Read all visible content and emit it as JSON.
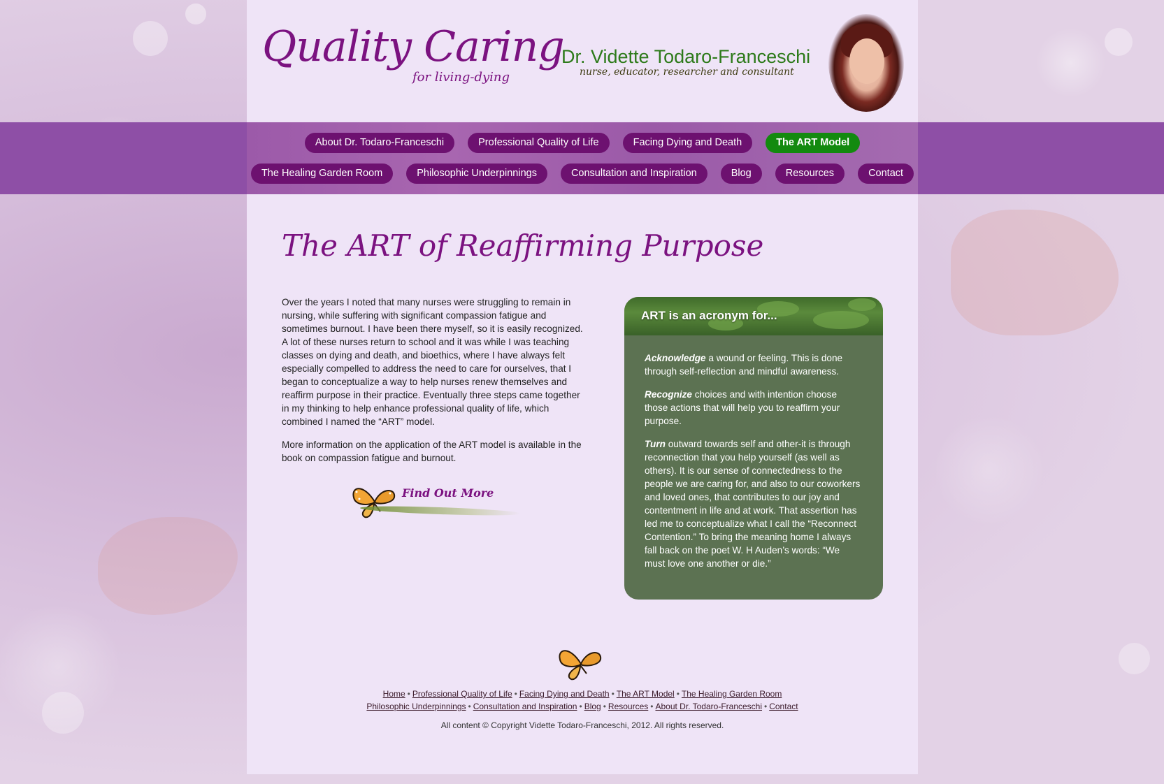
{
  "header": {
    "logo_main": "Quality Caring",
    "logo_sub": "for living-dying",
    "doctor_name": "Dr. Vidette Todaro-Franceschi",
    "doctor_title": "nurse, educator, researcher and consultant"
  },
  "nav": {
    "row1": [
      {
        "label": "About Dr. Todaro-Franceschi",
        "active": false
      },
      {
        "label": "Professional Quality of Life",
        "active": false
      },
      {
        "label": "Facing Dying and Death",
        "active": false
      },
      {
        "label": "The ART Model",
        "active": true
      }
    ],
    "row2": [
      {
        "label": "The Healing Garden Room",
        "active": false
      },
      {
        "label": "Philosophic Underpinnings",
        "active": false
      },
      {
        "label": "Consultation and Inspiration",
        "active": false
      },
      {
        "label": "Blog",
        "active": false
      },
      {
        "label": "Resources",
        "active": false
      },
      {
        "label": "Contact",
        "active": false
      }
    ],
    "colors": {
      "button": "#6d1170",
      "active": "#138a0f",
      "band": "#8e4fa6"
    }
  },
  "main": {
    "title": "The ART of Reaffirming Purpose",
    "paragraphs": [
      "Over the years I noted that many nurses were struggling to remain in nursing, while suffering with significant compassion fatigue and sometimes burnout. I have been there myself, so it is easily recognized. A lot of these nurses return to school and it was while I was teaching classes on dying and death, and bioethics, where I have always felt especially compelled to address the need to care for ourselves, that I began to conceptualize a way to help nurses renew themselves and reaffirm purpose in their practice. Eventually three steps came together in my thinking to help enhance professional quality of life, which combined I named the “ART” model.",
      "More information on the application of the ART model is available in the book on compassion fatigue and burnout."
    ],
    "find_more_label": "Find Out More"
  },
  "art_box": {
    "title": "ART is an acronym for...",
    "items": [
      {
        "term": "Acknowledge",
        "text": " a wound or feeling. This is done through self-reflection and mindful awareness."
      },
      {
        "term": "Recognize",
        "text": " choices and with intention choose those actions that will help you to reaffirm your purpose."
      },
      {
        "term": "Turn",
        "text": " outward towards self and other-it is through reconnection that you help yourself (as well as others). It is our sense of connectedness to the people we are caring for, and also to our coworkers and loved ones, that contributes to our joy and contentment in life and at work. That assertion has led me to conceptualize what I call the “Reconnect Contention.” To bring the meaning home I always fall back on the poet W. H Auden’s words: “We must love one another or die.”"
      }
    ]
  },
  "footer": {
    "row1": [
      "Home",
      "Professional Quality of Life",
      "Facing Dying and Death",
      "The ART Model",
      "The Healing Garden Room"
    ],
    "row2": [
      "Philosophic Underpinnings",
      "Consultation and Inspiration",
      "Blog",
      "Resources",
      "About Dr. Todaro-Franceschi",
      "Contact"
    ],
    "separator": "•",
    "copyright": "All content © Copyright Vidette Todaro-Franceschi, 2012. All rights reserved."
  },
  "icons": {
    "butterfly": "butterfly-icon",
    "portrait": "portrait-photo"
  }
}
